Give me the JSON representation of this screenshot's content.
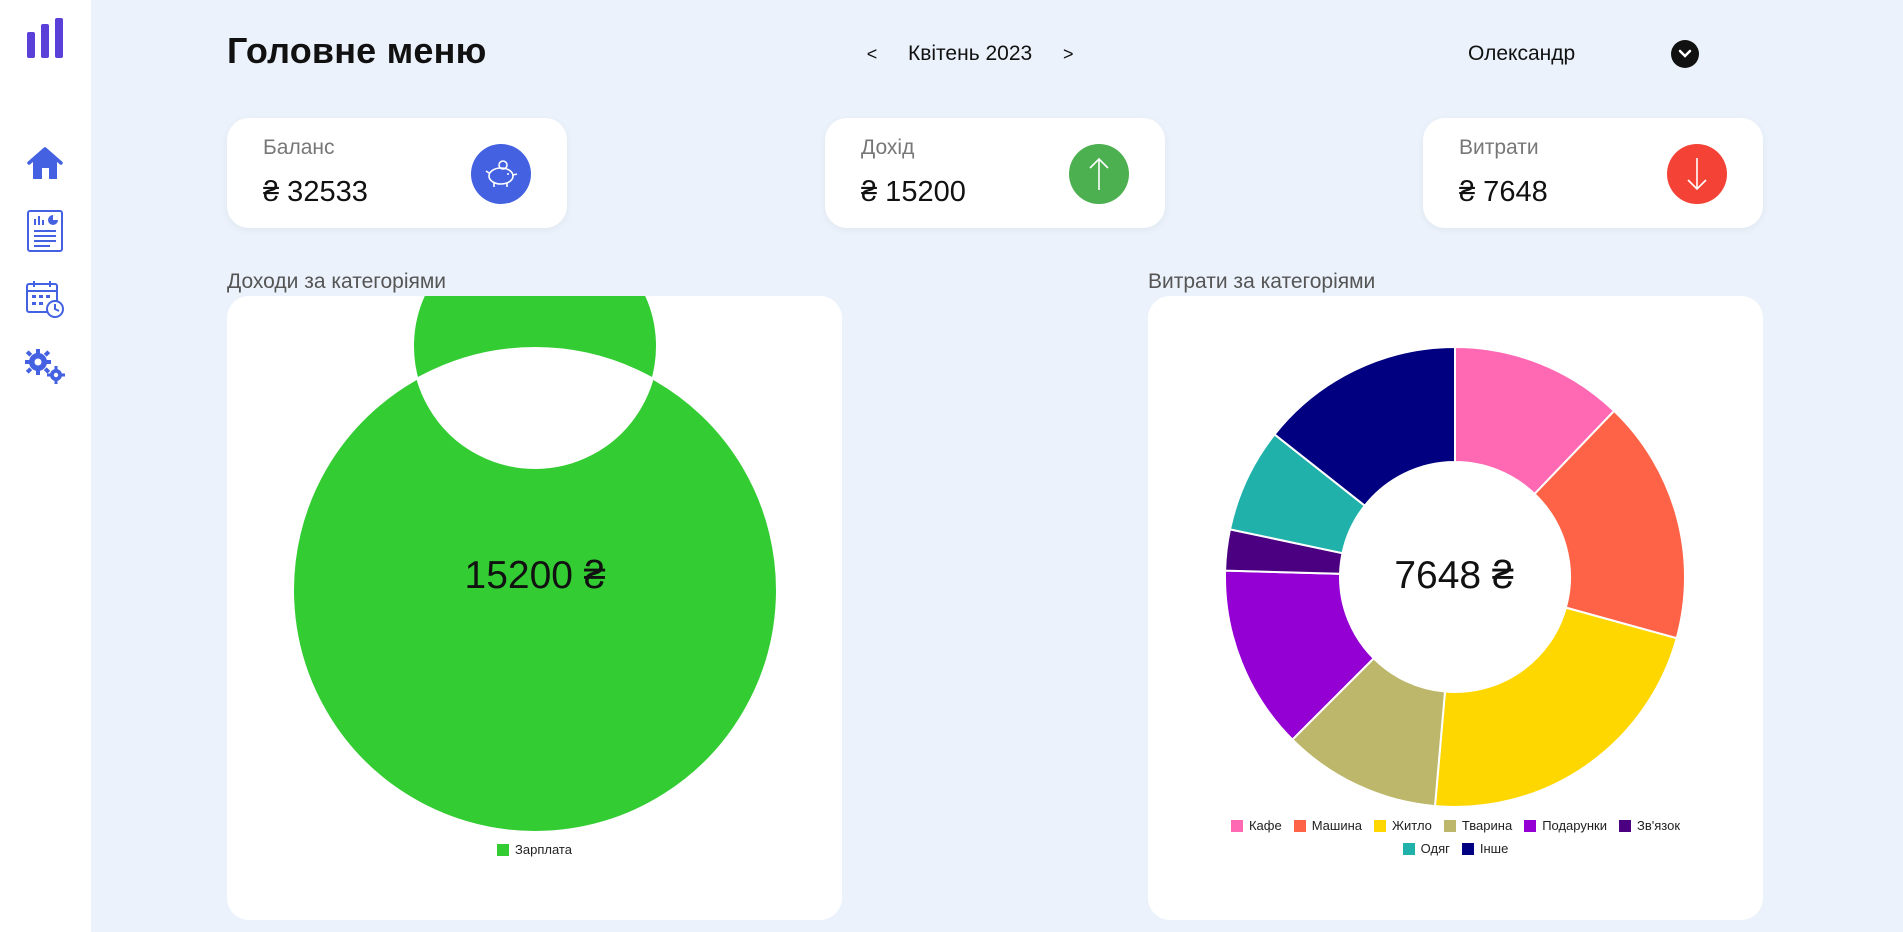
{
  "header": {
    "title": "Головне меню",
    "prev": "<",
    "month": "Квітень 2023",
    "next": ">",
    "user_name": "Олександр"
  },
  "sidebar": {
    "items": [
      {
        "name": "home-icon"
      },
      {
        "name": "report-icon"
      },
      {
        "name": "calendar-icon"
      },
      {
        "name": "settings-icon"
      }
    ]
  },
  "cards": {
    "balance": {
      "label": "Баланс",
      "value": "₴ 32533",
      "icon": "piggy-bank-icon",
      "color": "#4361e0"
    },
    "income": {
      "label": "Дохід",
      "value": "₴ 15200",
      "icon": "arrow-up-icon",
      "color": "#4caf50"
    },
    "expenses": {
      "label": "Витрати",
      "value": "₴ 7648",
      "icon": "arrow-down-icon",
      "color": "#f44336"
    }
  },
  "income_section": {
    "title": "Доходи за категоріями",
    "center": "15200 ₴"
  },
  "expense_section": {
    "title": "Витрати за категоріями",
    "center": "7648 ₴"
  },
  "chart_data": [
    {
      "type": "pie",
      "title": "Доходи за категоріями",
      "categories": [
        "Зарплата"
      ],
      "values": [
        15200
      ],
      "colors": [
        "#33cc33"
      ]
    },
    {
      "type": "pie",
      "title": "Витрати за категоріями",
      "categories": [
        "Кафе",
        "Машина",
        "Житло",
        "Тварина",
        "Подарунки",
        "Зв'язок",
        "Одяг",
        "Інше"
      ],
      "values": [
        930,
        1310,
        1690,
        850,
        990,
        220,
        560,
        1098
      ],
      "colors": [
        "#ff69b4",
        "#ff6347",
        "#ffd700",
        "#bdb76b",
        "#9400d3",
        "#4b0082",
        "#20b2aa",
        "#000080"
      ]
    }
  ]
}
